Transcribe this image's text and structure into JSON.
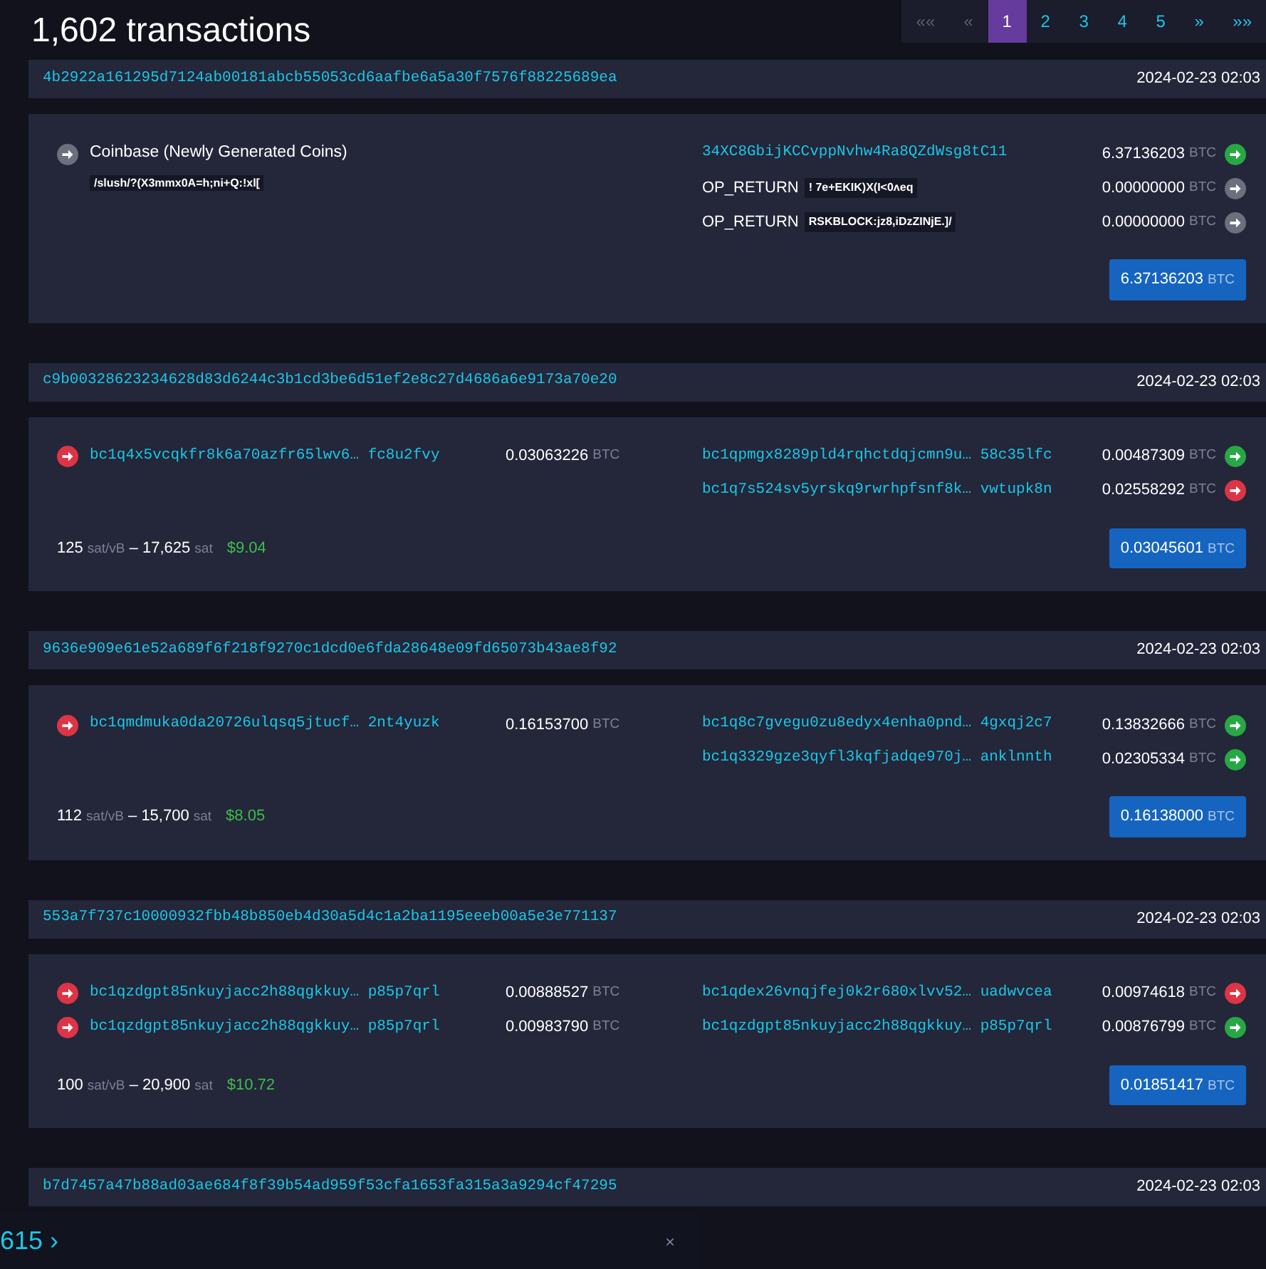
{
  "title": "1,602 transactions",
  "pagination": [
    {
      "label": "««",
      "selected": false,
      "disabled": true
    },
    {
      "label": "«",
      "selected": false,
      "disabled": true
    },
    {
      "label": "1",
      "selected": true,
      "disabled": false
    },
    {
      "label": "2",
      "selected": false,
      "disabled": false
    },
    {
      "label": "3",
      "selected": false,
      "disabled": false
    },
    {
      "label": "4",
      "selected": false,
      "disabled": false
    },
    {
      "label": "5",
      "selected": false,
      "disabled": false
    },
    {
      "label": "»",
      "selected": false,
      "disabled": false
    },
    {
      "label": "»»",
      "selected": false,
      "disabled": false
    }
  ],
  "transactions": [
    {
      "txid": "4b2922a161295d7124ab00181abcb55053cd6aafbe6a5a30f7576f88225689ea",
      "time": "2024-02-23 02:03",
      "inputs": [
        {
          "kind": "coinbase",
          "label": "Coinbase (Newly Generated Coins)",
          "script": "/slush/?(X3mmx0A=h;ni+Q:!xl["
        }
      ],
      "outputs": [
        {
          "kind": "address",
          "address": "34XC8GbijKCCvppNvhw4Ra8QZdWsg8tC11",
          "amount": "6.37136203",
          "unit": "BTC",
          "spent": false
        },
        {
          "kind": "op_return",
          "label": "OP_RETURN",
          "data": "! 7e+EKIK)X(I<0ʌeq",
          "amount": "0.00000000",
          "unit": "BTC"
        },
        {
          "kind": "op_return",
          "label": "OP_RETURN",
          "data": "RSKBLOCK:jz8,iDzZINjE.]/",
          "amount": "0.00000000",
          "unit": "BTC"
        }
      ],
      "total": {
        "amount": "6.37136203",
        "unit": "BTC"
      }
    },
    {
      "txid": "c9b00328623234628d83d6244c3b1cd3be6d51ef2e8c27d4686a6e9173a70e20",
      "time": "2024-02-23 02:03",
      "inputs": [
        {
          "kind": "address",
          "address": "bc1q4x5vcqkfr8k6a70azfr65lwv6… fc8u2fvy",
          "amount": "0.03063226",
          "unit": "BTC"
        }
      ],
      "outputs": [
        {
          "kind": "address",
          "address": "bc1qpmgx8289pld4rqhctdqjcmn9u… 58c35lfc",
          "amount": "0.00487309",
          "unit": "BTC",
          "spent": false
        },
        {
          "kind": "address",
          "address": "bc1q7s524sv5yrskq9rwrhpfsnf8k… vwtupk8n",
          "amount": "0.02558292",
          "unit": "BTC",
          "spent": true
        }
      ],
      "fee": {
        "rate": "125",
        "rate_unit": "sat/vB",
        "separator": "–",
        "total": "17,625",
        "total_unit": "sat",
        "usd": "$9.04"
      },
      "total": {
        "amount": "0.03045601",
        "unit": "BTC"
      }
    },
    {
      "txid": "9636e909e61e52a689f6f218f9270c1dcd0e6fda28648e09fd65073b43ae8f92",
      "time": "2024-02-23 02:03",
      "inputs": [
        {
          "kind": "address",
          "address": "bc1qmdmuka0da20726ulqsq5jtucf… 2nt4yuzk",
          "amount": "0.16153700",
          "unit": "BTC"
        }
      ],
      "outputs": [
        {
          "kind": "address",
          "address": "bc1q8c7gvegu0zu8edyx4enha0pnd… 4gxqj2c7",
          "amount": "0.13832666",
          "unit": "BTC",
          "spent": false
        },
        {
          "kind": "address",
          "address": "bc1q3329gze3qyfl3kqfjadqe970j… anklnnth",
          "amount": "0.02305334",
          "unit": "BTC",
          "spent": false
        }
      ],
      "fee": {
        "rate": "112",
        "rate_unit": "sat/vB",
        "separator": "–",
        "total": "15,700",
        "total_unit": "sat",
        "usd": "$8.05"
      },
      "total": {
        "amount": "0.16138000",
        "unit": "BTC"
      }
    },
    {
      "txid": "553a7f737c10000932fbb48b850eb4d30a5d4c1a2ba1195eeeb00a5e3e771137",
      "time": "2024-02-23 02:03",
      "inputs": [
        {
          "kind": "address",
          "address": "bc1qzdgpt85nkuyjacc2h88qgkkuy… p85p7qrl",
          "amount": "0.00888527",
          "unit": "BTC"
        },
        {
          "kind": "address",
          "address": "bc1qzdgpt85nkuyjacc2h88qgkkuy… p85p7qrl",
          "amount": "0.00983790",
          "unit": "BTC"
        }
      ],
      "outputs": [
        {
          "kind": "address",
          "address": "bc1qdex26vnqjfej0k2r680xlvv52… uadwvcea",
          "amount": "0.00974618",
          "unit": "BTC",
          "spent": true
        },
        {
          "kind": "address",
          "address": "bc1qzdgpt85nkuyjacc2h88qgkkuy… p85p7qrl",
          "amount": "0.00876799",
          "unit": "BTC",
          "spent": false
        }
      ],
      "fee": {
        "rate": "100",
        "rate_unit": "sat/vB",
        "separator": "–",
        "total": "20,900",
        "total_unit": "sat",
        "usd": "$10.72"
      },
      "total": {
        "amount": "0.01851417",
        "unit": "BTC"
      }
    },
    {
      "txid": "b7d7457a47b88ad03ae684f8f39b54ad959f53cfa1653fa315a3a9294cf47295",
      "time": "2024-02-23 02:03"
    }
  ],
  "overlay": {
    "label": "615",
    "arrow": "›",
    "close": "×"
  }
}
